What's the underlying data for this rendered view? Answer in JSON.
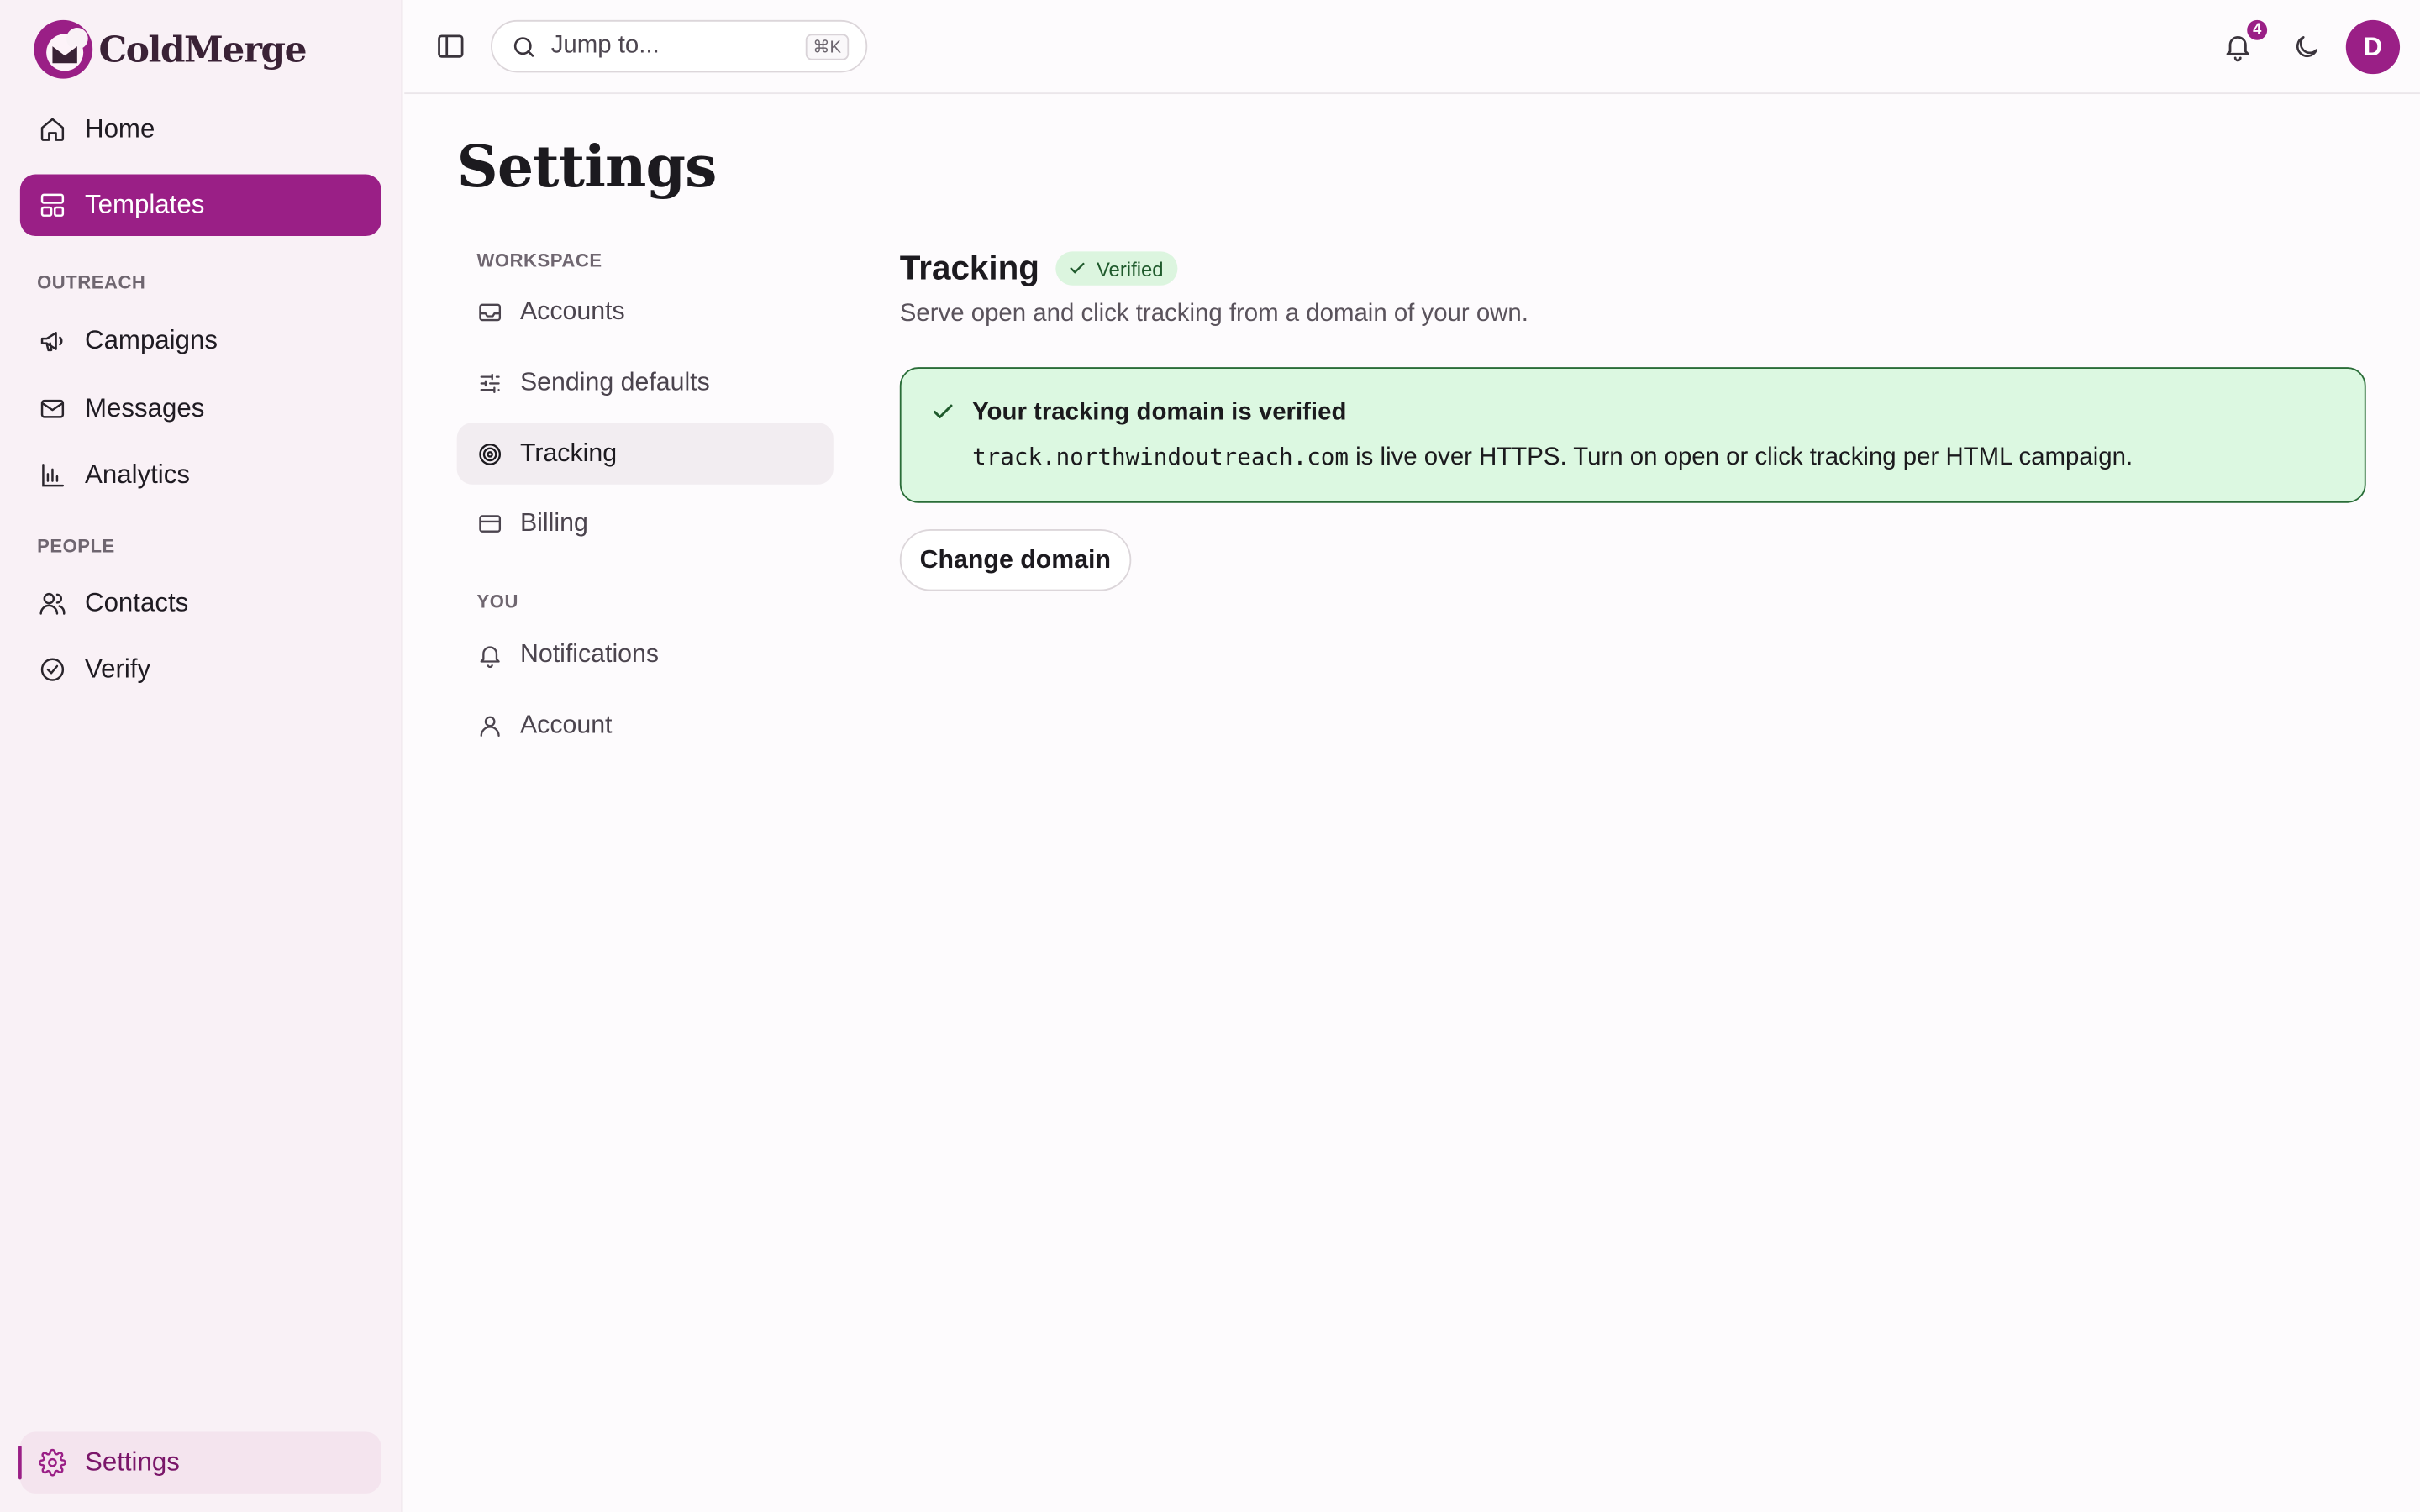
{
  "brand": {
    "name": "ColdMerge",
    "accent": "#9a1f86"
  },
  "sidebar": {
    "items": [
      {
        "label": "Home",
        "icon": "home-icon"
      },
      {
        "label": "Templates",
        "icon": "layout-icon",
        "active": true
      }
    ],
    "sections": [
      {
        "label": "OUTREACH",
        "items": [
          {
            "label": "Campaigns",
            "icon": "megaphone-icon"
          },
          {
            "label": "Messages",
            "icon": "mail-icon"
          },
          {
            "label": "Analytics",
            "icon": "bar-chart-icon"
          }
        ]
      },
      {
        "label": "PEOPLE",
        "items": [
          {
            "label": "Contacts",
            "icon": "users-icon"
          },
          {
            "label": "Verify",
            "icon": "badge-check-icon"
          }
        ]
      }
    ],
    "settings": {
      "label": "Settings",
      "icon": "gear-icon"
    }
  },
  "topbar": {
    "search": {
      "placeholder": "Jump to...",
      "shortcut": "⌘K"
    },
    "notifications_count": "4",
    "avatar_initial": "D"
  },
  "page": {
    "title": "Settings"
  },
  "settings_nav": {
    "groups": [
      {
        "label": "WORKSPACE",
        "items": [
          {
            "label": "Accounts",
            "icon": "inbox-icon"
          },
          {
            "label": "Sending defaults",
            "icon": "sliders-icon"
          },
          {
            "label": "Tracking",
            "icon": "target-icon",
            "active": true
          },
          {
            "label": "Billing",
            "icon": "credit-card-icon"
          }
        ]
      },
      {
        "label": "YOU",
        "items": [
          {
            "label": "Notifications",
            "icon": "bell-icon"
          },
          {
            "label": "Account",
            "icon": "user-icon"
          }
        ]
      }
    ]
  },
  "tracking": {
    "title": "Tracking",
    "badge": "Verified",
    "description": "Serve open and click tracking from a domain of your own.",
    "alert": {
      "title": "Your tracking domain is verified",
      "domain": "track.northwindoutreach.com",
      "body": " is live over HTTPS. Turn on open or click tracking per HTML campaign."
    },
    "change_button": "Change domain"
  }
}
